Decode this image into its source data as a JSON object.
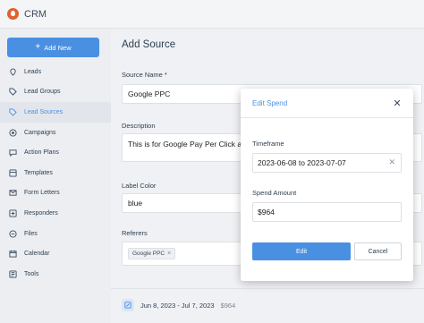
{
  "app": {
    "title": "CRM"
  },
  "sidebar": {
    "add_new_label": "Add New",
    "items": [
      {
        "label": "Leads",
        "icon": "location-pin-icon"
      },
      {
        "label": "Lead Groups",
        "icon": "tag-icon"
      },
      {
        "label": "Lead Sources",
        "icon": "tag-icon",
        "active": true
      },
      {
        "label": "Campaigns",
        "icon": "target-icon"
      },
      {
        "label": "Action Plans",
        "icon": "chat-icon"
      },
      {
        "label": "Templates",
        "icon": "template-icon"
      },
      {
        "label": "Form Letters",
        "icon": "envelope-icon"
      },
      {
        "label": "Responders",
        "icon": "responder-icon"
      },
      {
        "label": "Files",
        "icon": "folder-icon"
      },
      {
        "label": "Calendar",
        "icon": "calendar-icon"
      },
      {
        "label": "Tools",
        "icon": "tools-icon"
      }
    ]
  },
  "main": {
    "title": "Add Source",
    "source_name_label": "Source Name *",
    "source_name_value": "Google PPC",
    "description_label": "Description",
    "description_value": "This is for Google Pay Per Click ar",
    "label_color_label": "Label Color",
    "label_color_value": "blue",
    "referers_label": "Referers",
    "referer_tag": "Google PPC",
    "spend_range": "Jun 8, 2023 - Jul 7, 2023",
    "spend_amount": "$964"
  },
  "modal": {
    "title": "Edit Spend",
    "timeframe_label": "Timeframe",
    "timeframe_value": "2023-06-08 to 2023-07-07",
    "spend_amount_label": "Spend Amount",
    "spend_amount_value": "$964",
    "edit_label": "Edit",
    "cancel_label": "Cancel"
  },
  "colors": {
    "accent": "#4a90e2",
    "logo": "#e0622d"
  }
}
